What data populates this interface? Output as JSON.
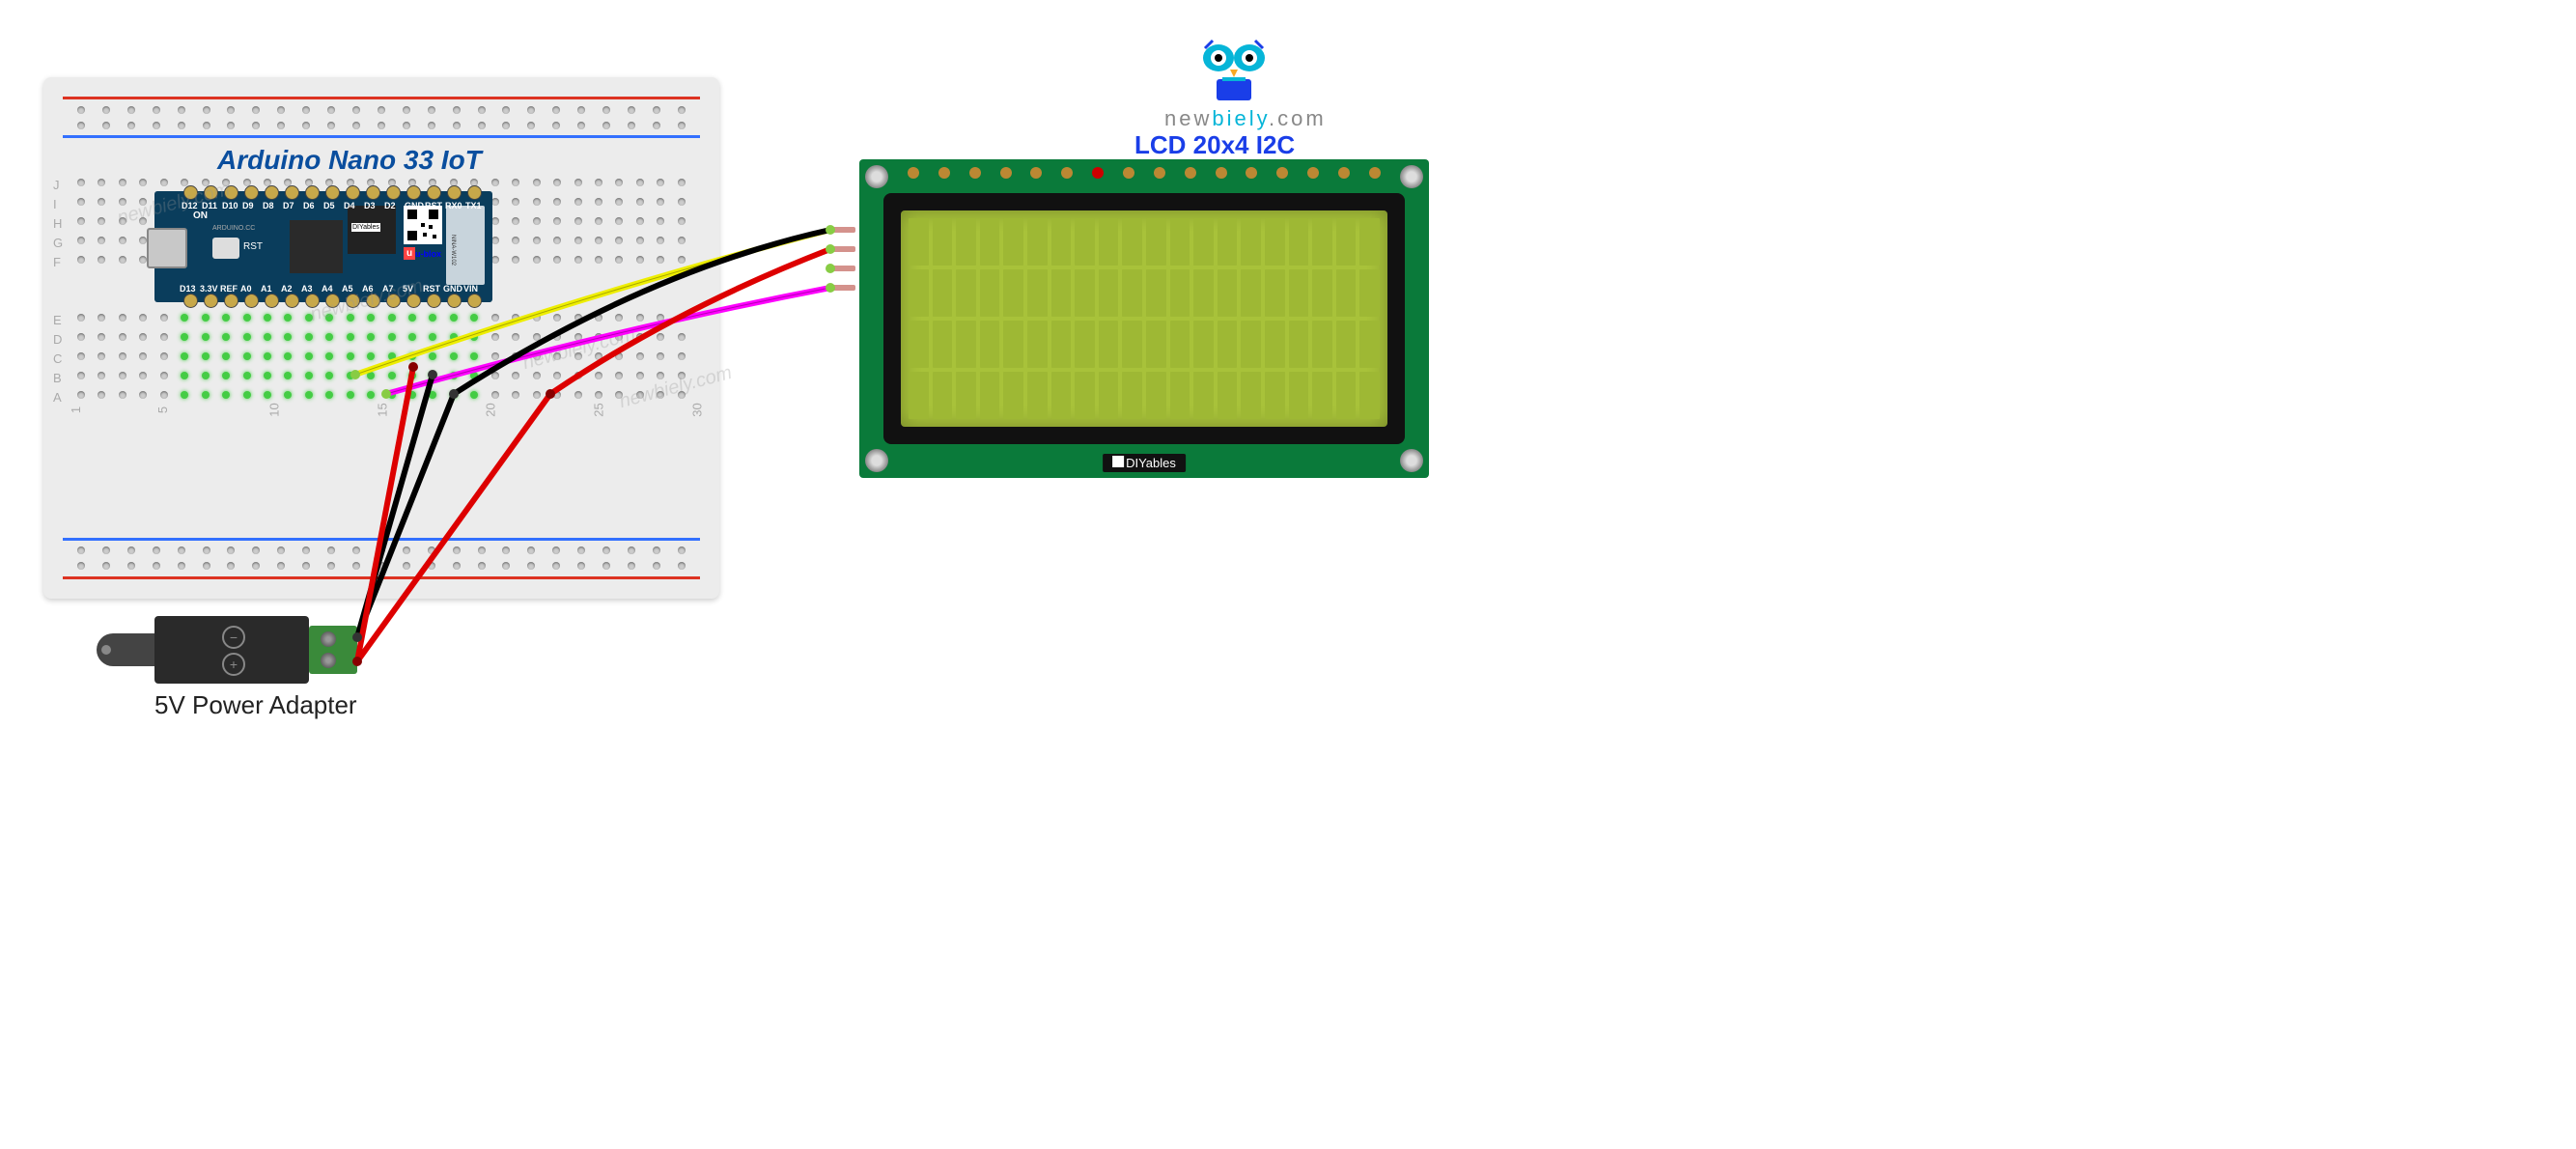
{
  "logo": {
    "brand_gray": "new",
    "brand_blue": "biely",
    "brand_suffix": ".com"
  },
  "lcd": {
    "title": "LCD 20x4 I2C",
    "brand": "DIYables",
    "cols": 20,
    "rows": 4,
    "pin_count": 4,
    "solder_pads": 16
  },
  "arduino": {
    "title": "Arduino Nano 33 IoT",
    "silkscreen": "ARDUINO.CC",
    "on_label": "ON",
    "rst_label": "RST",
    "wifi_module": "NINA-W102",
    "ublox": "u-blox",
    "diyables_chip": "DIYables",
    "pins_top": [
      "D12",
      "D11",
      "D10",
      "D9",
      "D8",
      "D7",
      "D6",
      "D5",
      "D4",
      "D3",
      "D2",
      "GND",
      "RST",
      "RX0",
      "TX1"
    ],
    "pins_bottom": [
      "D13",
      "3.3V",
      "REF",
      "A0",
      "A1",
      "A2",
      "A3",
      "A4",
      "A5",
      "A6",
      "A7",
      "5V",
      "RST",
      "GND",
      "VIN"
    ]
  },
  "breadboard": {
    "letters": [
      "A",
      "B",
      "C",
      "D",
      "E",
      "F",
      "G",
      "H",
      "I",
      "J"
    ],
    "numbers": [
      "1",
      "5",
      "10",
      "15",
      "20",
      "25",
      "30"
    ]
  },
  "power": {
    "label": "5V Power Adapter"
  },
  "wires": [
    {
      "name": "gnd-black-lcd",
      "color": "#000",
      "from": "breadboard",
      "to": "lcd-gnd"
    },
    {
      "name": "vcc-red-lcd",
      "color": "#d00",
      "from": "breadboard",
      "to": "lcd-vcc"
    },
    {
      "name": "sda-yellow",
      "color": "#ee0",
      "from": "A4",
      "to": "lcd-sda"
    },
    {
      "name": "scl-magenta",
      "color": "#f0f",
      "from": "A5",
      "to": "lcd-scl"
    },
    {
      "name": "gnd-black-power",
      "color": "#000",
      "from": "terminal",
      "to": "breadboard-gnd"
    },
    {
      "name": "vcc-red-power",
      "color": "#d00",
      "from": "terminal",
      "to": "breadboard-5v"
    }
  ],
  "watermark": "newbiely.com"
}
